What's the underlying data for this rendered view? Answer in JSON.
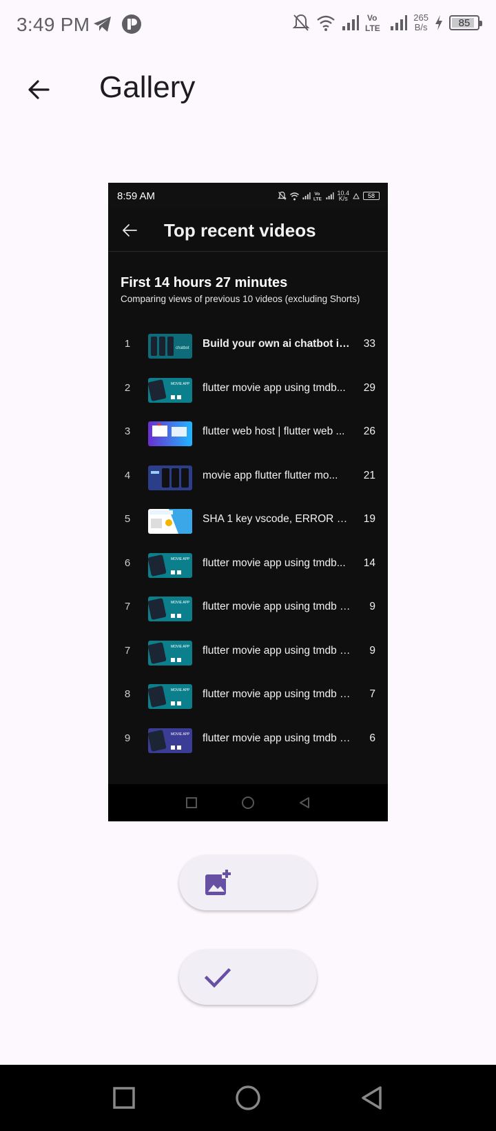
{
  "status_bar": {
    "time": "3:49 PM",
    "net_speed_value": "265",
    "net_speed_unit": "B/s",
    "battery": "85"
  },
  "appbar": {
    "title": "Gallery"
  },
  "screenshot": {
    "status_bar": {
      "time": "8:59 AM",
      "net_speed_value": "10.4",
      "net_speed_unit": "K/s",
      "battery": "58"
    },
    "title": "Top recent videos",
    "heading": "First 14 hours 27 minutes",
    "subheading": "Comparing views of previous 10 videos (excluding Shorts)",
    "videos": [
      {
        "rank": "1",
        "title": "Build your own ai chatbot in ...",
        "views": "33",
        "thumb": "phones-teal"
      },
      {
        "rank": "2",
        "title": "flutter movie app using tmdb...",
        "views": "29",
        "thumb": "movie-app-teal"
      },
      {
        "rank": "3",
        "title": "flutter web host | flutter web ...",
        "views": "26",
        "thumb": "web-host-blue"
      },
      {
        "rank": "4",
        "title": "movie app flutter   flutter mo...",
        "views": "21",
        "thumb": "phones-dark"
      },
      {
        "rank": "5",
        "title": "SHA 1 key vscode, ERROR ge...",
        "views": "19",
        "thumb": "sha1-key"
      },
      {
        "rank": "6",
        "title": "flutter movie app using tmdb...",
        "views": "14",
        "thumb": "movie-app-teal"
      },
      {
        "rank": "7",
        "title": "flutter movie app using tmdb a...",
        "views": "9",
        "thumb": "movie-app-teal"
      },
      {
        "rank": "7",
        "title": "flutter movie app using tmdb a...",
        "views": "9",
        "thumb": "movie-app-teal"
      },
      {
        "rank": "8",
        "title": "flutter movie app using tmdb a...",
        "views": "7",
        "thumb": "movie-app-teal"
      },
      {
        "rank": "9",
        "title": "flutter movie app using tmdb a...",
        "views": "6",
        "thumb": "movie-app-purple"
      }
    ]
  },
  "actions": {
    "add_image_icon": "add-photo-icon",
    "confirm_icon": "check-icon"
  },
  "colors": {
    "background": "#fdf8fd",
    "accent": "#6750a4",
    "fab_bg": "#f2eef6"
  }
}
